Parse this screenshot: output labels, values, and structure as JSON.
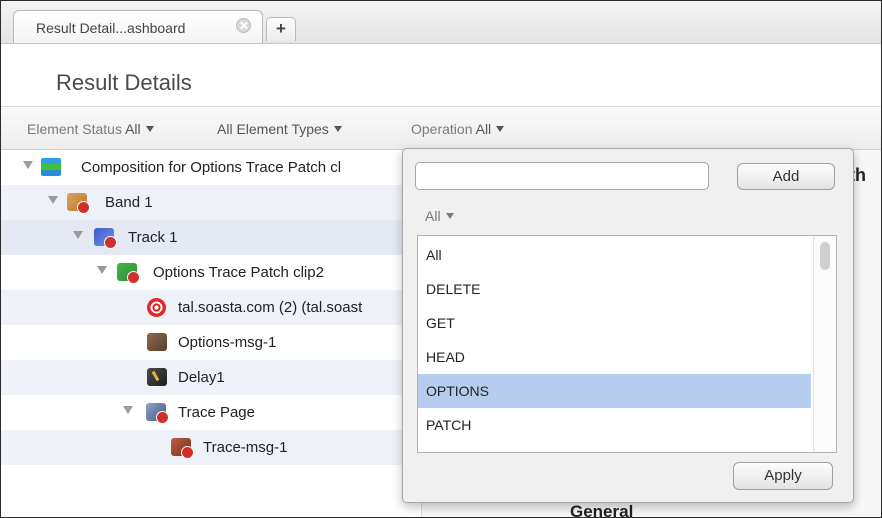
{
  "tabs": [
    {
      "title": "Result Detail...ashboard"
    }
  ],
  "tab_add_label": "+",
  "header": {
    "title": "Result Details"
  },
  "filters": {
    "element_status": {
      "label": "Element Status",
      "value": "All"
    },
    "element_types": {
      "label": "",
      "value": "All Element Types"
    },
    "operation": {
      "label": "Operation",
      "value": "All"
    }
  },
  "tree": [
    {
      "label": "Composition for Options Trace Patch cl",
      "icon": "composition-icon"
    },
    {
      "label": "Band 1",
      "icon": "band-error-icon"
    },
    {
      "label": "Track 1",
      "icon": "track-error-icon"
    },
    {
      "label": "Options Trace Patch clip2",
      "icon": "clip-error-icon"
    },
    {
      "label": "tal.soasta.com (2) (tal.soast",
      "icon": "target-icon"
    },
    {
      "label": "Options-msg-1",
      "icon": "message-icon"
    },
    {
      "label": "Delay1",
      "icon": "delay-icon"
    },
    {
      "label": "Trace Page",
      "icon": "page-error-icon"
    },
    {
      "label": "Trace-msg-1",
      "icon": "message-error-icon"
    }
  ],
  "background": {
    "partial_title": "ith",
    "section_label": "General"
  },
  "popup": {
    "search": {
      "value": "",
      "placeholder": ""
    },
    "add_label": "Add",
    "subfilter": "All",
    "options": [
      "All",
      "DELETE",
      "GET",
      "HEAD",
      "OPTIONS",
      "PATCH"
    ],
    "selected": "OPTIONS",
    "apply_label": "Apply"
  }
}
